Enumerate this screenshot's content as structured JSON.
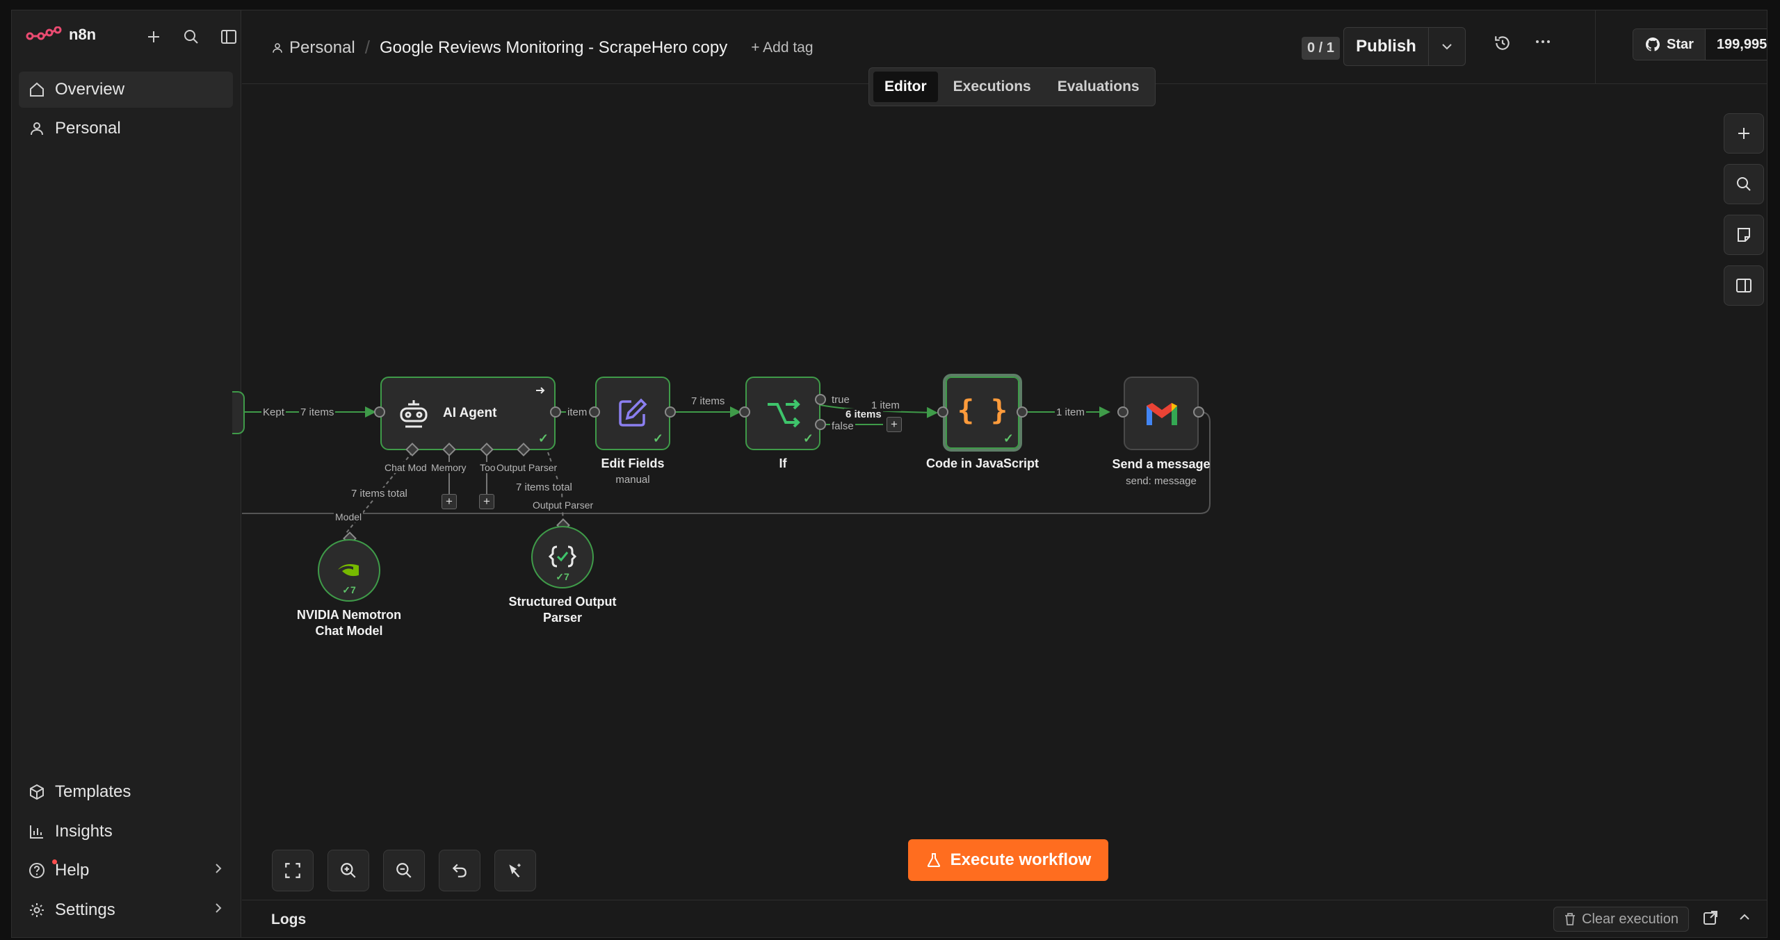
{
  "app": {
    "logo_text": "n8n"
  },
  "sidebar": {
    "items": [
      {
        "label": "Overview",
        "icon": "home-icon"
      },
      {
        "label": "Personal",
        "icon": "user-icon"
      }
    ],
    "bottom_items": [
      {
        "label": "Templates",
        "icon": "templates-icon"
      },
      {
        "label": "Insights",
        "icon": "insights-icon"
      },
      {
        "label": "Help",
        "icon": "help-icon"
      },
      {
        "label": "Settings",
        "icon": "gear-icon"
      }
    ]
  },
  "header": {
    "project": "Personal",
    "workflow_name": "Google Reviews Monitoring - ScrapeHero copy",
    "add_tag": "+ Add tag",
    "counter": "0 / 1",
    "publish_label": "Publish",
    "github_star": "Star",
    "github_count": "199,995"
  },
  "tabs": [
    "Editor",
    "Executions",
    "Evaluations"
  ],
  "nodes": {
    "ai_agent": {
      "label": "AI Agent"
    },
    "edit_fields": {
      "label": "Edit Fields",
      "sub": "manual"
    },
    "if": {
      "label": "If"
    },
    "code": {
      "label": "Code in JavaScript"
    },
    "gmail": {
      "label": "Send a message",
      "sub": "send: message"
    },
    "nvidia": {
      "label": "NVIDIA Nemotron Chat Model",
      "label_1": "NVIDIA Nemotron",
      "label_2": "Chat Model",
      "count": "✓7"
    },
    "parser": {
      "label": "Structured Output Parser",
      "label_1": "Structured Output",
      "label_2": "Parser",
      "count": "✓7"
    }
  },
  "edge_labels": {
    "kept": "Kept",
    "seven_items_1": "7 items",
    "item": "item",
    "seven_items_2": "7 items",
    "true": "true",
    "false": "false",
    "one_item_1": "1 item",
    "six_items": "6 items",
    "one_item_2": "1 item",
    "chat_model": "Chat Mod",
    "memory": "Memory",
    "tool": "Too",
    "output_parser": "Output Parser",
    "items_total_1": "7 items total",
    "items_total_2": "7 items total",
    "model": "Model",
    "output_parser_2": "Output Parser"
  },
  "toolbar": {
    "execute_label": "Execute workflow"
  },
  "logs": {
    "title": "Logs",
    "clear_label": "Clear execution"
  },
  "colors": {
    "accent": "#ff6d1f",
    "success": "#3f9b49",
    "gmail_red": "#ea4335"
  }
}
